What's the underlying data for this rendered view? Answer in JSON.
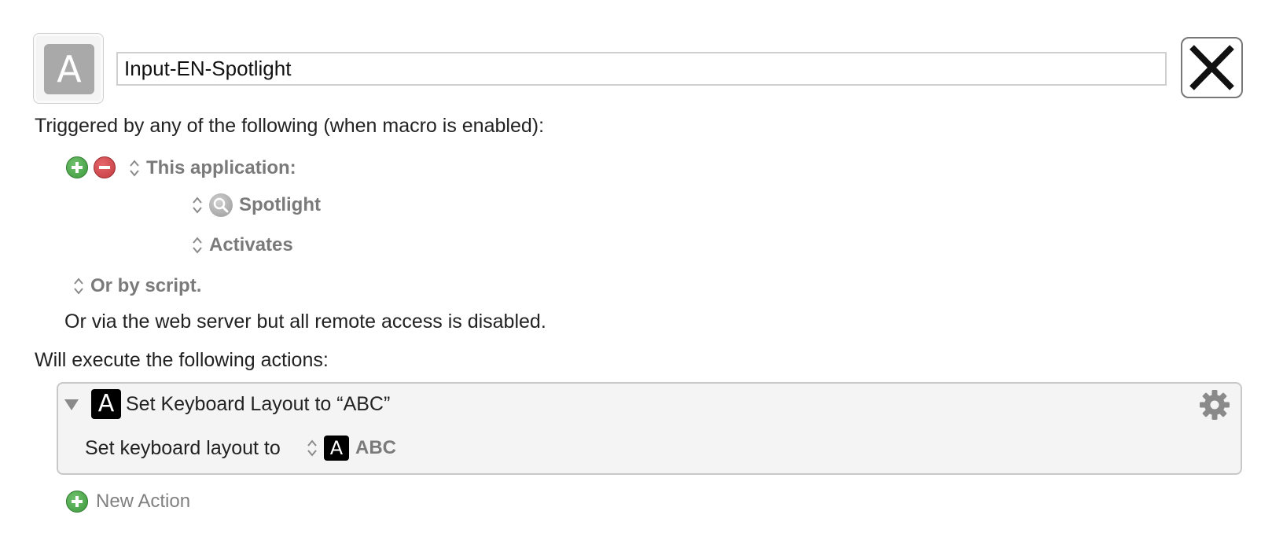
{
  "macro": {
    "icon_letter": "A",
    "name": "Input-EN-Spotlight"
  },
  "triggers": {
    "heading": "Triggered by any of the following (when macro is enabled):",
    "trigger_type": "This application:",
    "application": "Spotlight",
    "event": "Activates",
    "script_option": "Or by script.",
    "web_server_note": "Or via the web server but all remote access is disabled."
  },
  "actions": {
    "heading": "Will execute the following actions:",
    "items": [
      {
        "icon_letter": "A",
        "title": "Set Keyboard Layout to “ABC”",
        "param_label": "Set keyboard layout to",
        "param_icon_letter": "A",
        "param_value": "ABC"
      }
    ],
    "new_action_label": "New Action"
  },
  "icons": {
    "close": "close-x-icon",
    "add": "plus-circle-icon",
    "remove": "minus-circle-icon",
    "stepper": "up-down-stepper-icon",
    "spotlight": "magnifier-icon",
    "gear": "gear-icon",
    "disclosure": "disclosure-triangle-icon"
  },
  "colors": {
    "add_green": "#3e9a3c",
    "remove_red": "#c33a3f",
    "secondary_text": "#7a7a7a",
    "action_background": "#f4f4f4"
  }
}
